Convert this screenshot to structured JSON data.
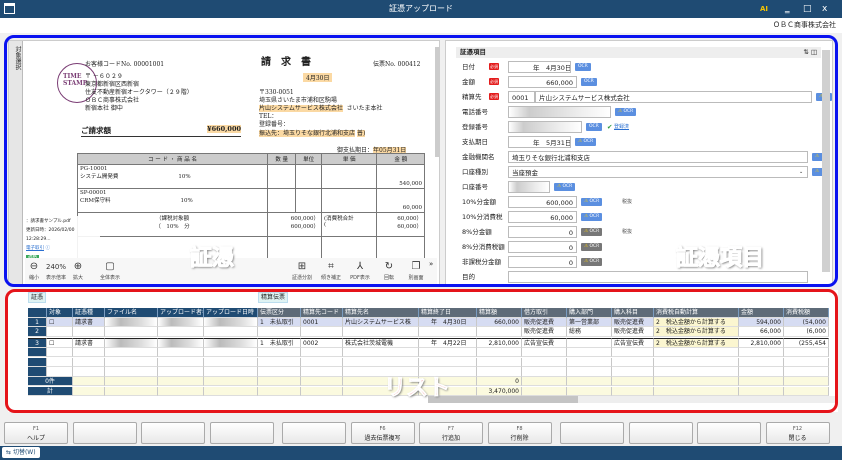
{
  "window": {
    "title": "証憑アップロード",
    "company": "ＯＢＣ商事株式会社",
    "minimize": "‗",
    "maximize": "□",
    "close": "x",
    "ai_icon": "AI"
  },
  "viewer": {
    "side_tab": "対象選択",
    "doc": {
      "title": "請　求　書",
      "customer_code": "お客様コードNo. 00001001",
      "slip_no": "伝票No. 000412",
      "date": "4月30日",
      "postal": "〒 －６０２９",
      "to_addr1": "東京都新宿区西新宿",
      "to_addr2": "住友不動産新宿オークタワー（２９階）",
      "to_name": "ＯＢＣ商事株式会社",
      "to_branch": "新宿本社 御中",
      "stamp": "TIME STAMP",
      "from_postal": "〒330-0051",
      "from_addr": "埼玉県さいたま市浦和区駒場",
      "from_name": "片山システムサービス株式会社",
      "from_branch": "さいたま本社",
      "tel": "TEL：",
      "reg": "登録番号：",
      "bank": "振込先：埼玉りそな銀行北浦和支店",
      "bank_suffix": "普)",
      "due": "御支払期日：",
      "due_date": "年05月31日",
      "amount_label": "ご請求額",
      "amount": "¥660,000",
      "headers": [
        "コ ー ド ・ 商 品 名",
        "数 量",
        "単位",
        "単 価",
        "金 額"
      ],
      "items": [
        {
          "code": "PG-10001",
          "name": "システム開発費",
          "tax": "10%",
          "amount": "540,000"
        },
        {
          "code": "SP-00001",
          "name": "CRM保守料",
          "tax": "10%",
          "amount": "60,000"
        }
      ],
      "sum1": "（課税対象額",
      "sum1v": "600,000）",
      "sum2": "（　10%　分",
      "sum2v": "600,000）",
      "tax1": "(消費税合計",
      "tax1v": "60,000）",
      "tax2": "(",
      "tax2v": "60,000）"
    },
    "file_name": "：請求書サンプル.pdf",
    "updated": "更新日時：2026/02/00 12:28:29...",
    "link": "電子取引",
    "badge": "適格",
    "zoom": "240%",
    "toolbar": [
      "縮小",
      "表示倍率",
      "拡大",
      "全体表示",
      "証憑分割",
      "傾き補正",
      "PDF表示",
      "回転",
      "別画面"
    ]
  },
  "form": {
    "title": "証憑項目",
    "required": "必須",
    "ocr": "OCR",
    "fields": [
      {
        "label": "日付",
        "value": "年　4月30日",
        "req": true,
        "ocr": "blue"
      },
      {
        "label": "金額",
        "value": "660,000",
        "req": true,
        "ocr": "blue"
      },
      {
        "label": "精算先",
        "code": "0001",
        "value": "片山システムサービス株式会社",
        "req": true,
        "ocr": "warn"
      },
      {
        "label": "電話番号",
        "value": "",
        "ocr": "warn"
      },
      {
        "label": "登録番号",
        "value": "",
        "ocr": "blue",
        "note": "登録済"
      },
      {
        "label": "支払期日",
        "value": "年　5月31日",
        "ocr": "warn"
      },
      {
        "label": "金融機関名",
        "value": "埼玉りそな銀行北浦和支店",
        "ocr": "warn"
      },
      {
        "label": "口座種別",
        "value": "当座預金",
        "ocr": "warn"
      },
      {
        "label": "口座番号",
        "value": "",
        "ocr": "warn"
      },
      {
        "label": "10%分金額",
        "value": "600,000",
        "ocr": "warn",
        "note": "税抜"
      },
      {
        "label": "10%分消費税",
        "value": "60,000",
        "ocr": "warn"
      },
      {
        "label": "8%分金額",
        "value": "0",
        "ocr": "gray",
        "note": "税抜"
      },
      {
        "label": "8%分消費税額",
        "value": "0",
        "ocr": "gray"
      },
      {
        "label": "非課税分金額",
        "value": "0",
        "ocr": "gray"
      },
      {
        "label": "目的",
        "value": ""
      }
    ]
  },
  "list": {
    "tag_left": "証憑",
    "tag_right": "精算伝票",
    "columns": [
      "",
      "対象",
      "証憑種",
      "ファイル名",
      "アップロード者名",
      "アップロード日時",
      "伝票区分",
      "精算先コード",
      "精算先名",
      "精算終了日",
      "精算額",
      "借方取引",
      "購入部門",
      "購入科目",
      "消費税自動計算",
      "金額",
      "消費税額"
    ],
    "rows": [
      [
        "1",
        "☐",
        "請求書",
        "",
        "",
        "",
        "1　未払取引",
        "0001",
        "片山システムサービス株",
        "年　4月30日",
        "660,000",
        "販売促進費",
        "第一営業部",
        "販売促進費",
        "2　税込金額から計算する",
        "594,000",
        "(54,000"
      ],
      [
        "2",
        "",
        "",
        "",
        "",
        "",
        "",
        "",
        "",
        "",
        "",
        "販売促進費",
        "総務",
        "販売促進費",
        "2　税込金額から計算する",
        "66,000",
        "(6,000"
      ],
      [
        "3",
        "☐",
        "請求書",
        "",
        "",
        "",
        "1　未払取引",
        "0002",
        "株式会社茨城電機",
        "年　4月22日",
        "2,810,000",
        "広告宣伝費",
        "",
        "広告宣伝費",
        "2　税込金額から計算する",
        "2,810,000",
        "(255,454"
      ],
      [
        "",
        "",
        "",
        "",
        "",
        "",
        "",
        "",
        "",
        "",
        "",
        "",
        "",
        "",
        "",
        "",
        ""
      ],
      [
        "",
        "",
        "",
        "",
        "",
        "",
        "",
        "",
        "",
        "",
        "",
        "",
        "",
        "",
        "",
        "",
        ""
      ],
      [
        "",
        "",
        "",
        "",
        "",
        "",
        "",
        "",
        "",
        "",
        "",
        "",
        "",
        "",
        "",
        "",
        ""
      ]
    ],
    "count_label": "0件",
    "count_value": "0",
    "total_label": "計",
    "total_value": "3,470,000"
  },
  "fkeys": [
    {
      "key": "F1",
      "label": "ヘルプ"
    },
    {
      "key": "",
      "label": ""
    },
    {
      "key": "",
      "label": ""
    },
    {
      "key": "",
      "label": ""
    },
    {
      "key": "",
      "label": ""
    },
    {
      "key": "F6",
      "label": "過去伝票複写"
    },
    {
      "key": "F7",
      "label": "行追加"
    },
    {
      "key": "F8",
      "label": "行削除"
    },
    {
      "key": "",
      "label": ""
    },
    {
      "key": "",
      "label": ""
    },
    {
      "key": "",
      "label": ""
    },
    {
      "key": "F12",
      "label": "閉じる"
    }
  ],
  "status": {
    "switch": "切替(W)"
  },
  "annotations": {
    "viewer": "証憑",
    "form": "証憑項目",
    "list": "リスト"
  }
}
